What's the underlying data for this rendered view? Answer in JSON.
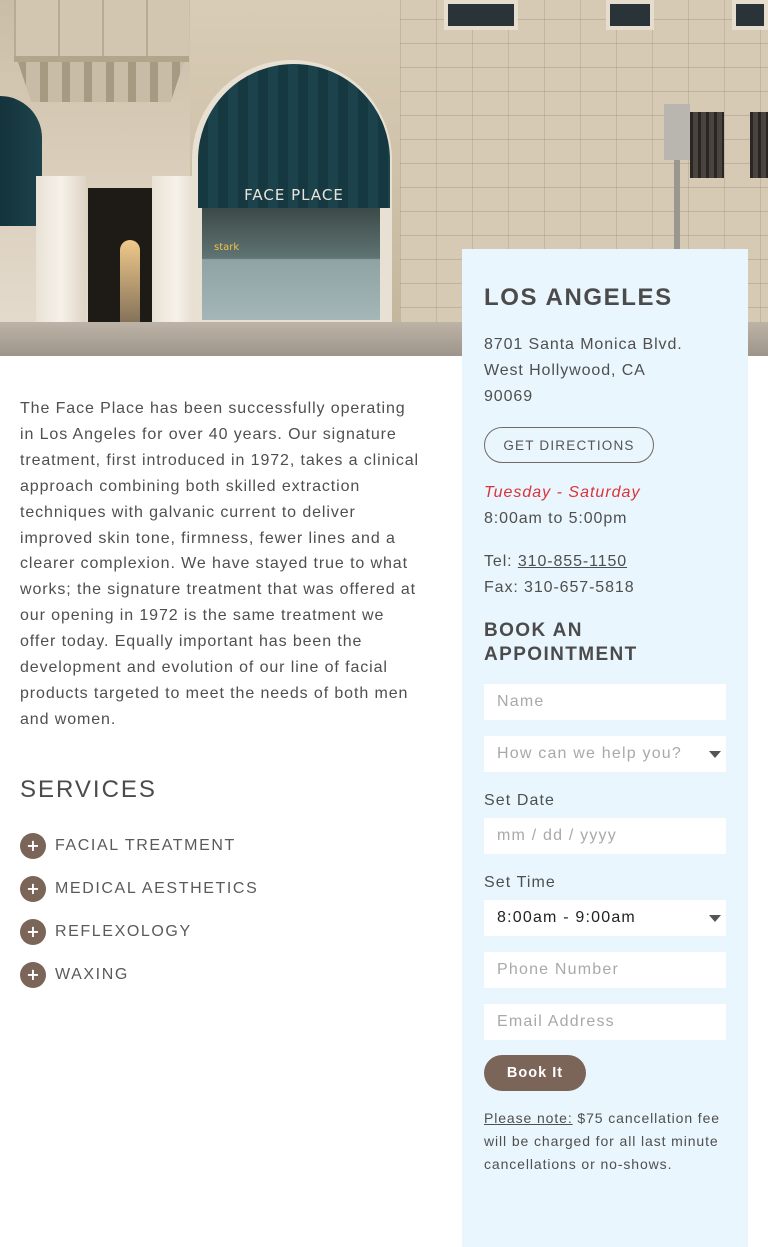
{
  "hero": {
    "awning_sign": "FACE PLACE",
    "window_label": "stark"
  },
  "about": {
    "text": "The Face Place has been successfully operating in Los Angeles for over 40 years. Our signature treatment, first introduced in 1972, takes a clinical approach combining both skilled extraction techniques with galvanic current to deliver improved skin tone, firmness, fewer lines and a clearer complexion. We have stayed true to what works; the signature treatment that was offered at our opening in 1972 is the same treatment we offer today. Equally important has been the development and evolution of our line of facial products targeted to meet the needs of both men and women."
  },
  "services": {
    "heading": "SERVICES",
    "items": [
      {
        "label": "FACIAL TREATMENT",
        "icon": "plus-icon"
      },
      {
        "label": "MEDICAL AESTHETICS",
        "icon": "plus-icon"
      },
      {
        "label": "REFLEXOLOGY",
        "icon": "plus-icon"
      },
      {
        "label": "WAXING",
        "icon": "plus-icon"
      }
    ]
  },
  "location": {
    "city": "LOS ANGELES",
    "address_line1": "8701 Santa Monica Blvd.",
    "address_line2": "West Hollywood, CA",
    "address_line3": "90069",
    "directions_label": "GET DIRECTIONS",
    "days": "Tuesday - Saturday",
    "hours": "8:00am to 5:00pm",
    "tel_label": "Tel: ",
    "tel_number": "310-855-1150",
    "fax": "Fax: 310-657-5818"
  },
  "booking": {
    "heading_line1": "BOOK AN",
    "heading_line2": "APPOINTMENT",
    "name_placeholder": "Name",
    "help_placeholder": "How can we help you?",
    "date_label": "Set Date",
    "date_placeholder": "mm / dd / yyyy",
    "time_label": "Set Time",
    "time_value": "8:00am - 9:00am",
    "phone_placeholder": "Phone Number",
    "email_placeholder": "Email Address",
    "submit_label": "Book It",
    "note_label": "Please note:",
    "note_text": " $75 cancellation fee will be charged for all last minute cancellations or no-shows."
  },
  "colors": {
    "panel_bg": "#eaf6fd",
    "accent_brown": "#7a6558",
    "days_red": "#d8343a"
  }
}
